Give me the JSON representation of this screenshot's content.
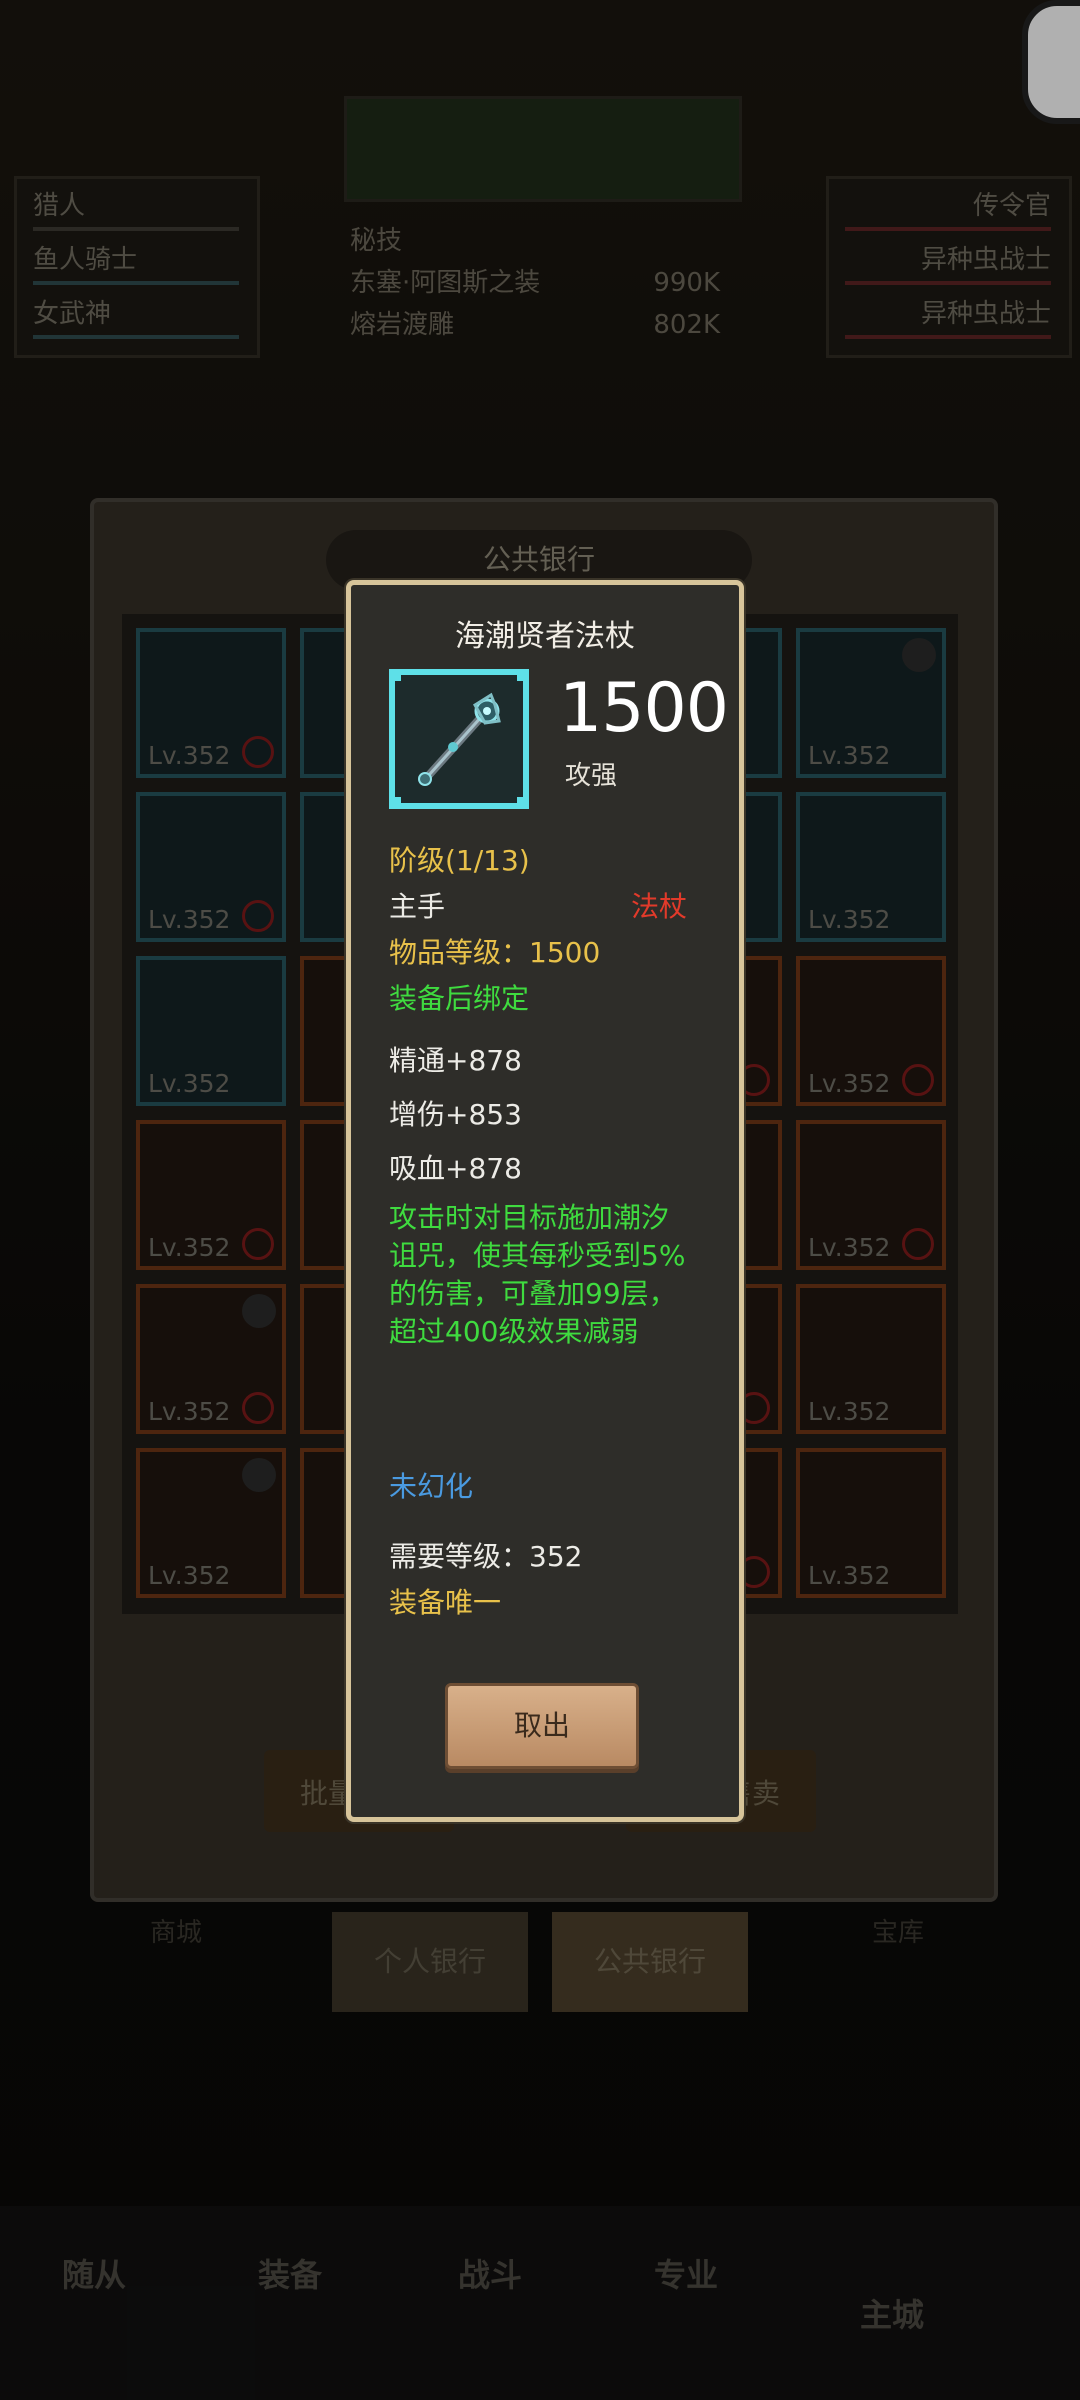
{
  "background": {
    "left_panel": {
      "header": "猎人",
      "rows": [
        "鱼人骑士",
        "女武神"
      ]
    },
    "right_panel": {
      "header": "传令官",
      "rows": [
        "异种虫战士",
        "异种虫战士"
      ]
    },
    "top_panel": {
      "stats": [
        {
          "name": "秘技",
          "value": ""
        },
        {
          "name": "东塞·阿图斯之装",
          "value": "990K"
        },
        {
          "name": "熔岩渡雕",
          "value": "802K"
        }
      ]
    },
    "bank": {
      "title": "公共银行",
      "level_label": "Lv.352",
      "batch_button": "批量",
      "sell_button": "售卖",
      "tabs": [
        "个人银行",
        "公共银行"
      ],
      "left_tab": "商城",
      "right_tab": "宝库"
    },
    "bottom_nav": [
      "随从",
      "装备",
      "战斗",
      "专业",
      "主城"
    ]
  },
  "item": {
    "name": "海潮贤者法杖",
    "power": "1500",
    "power_label": "攻强",
    "tier": "阶级(1/13)",
    "slot": "主手",
    "type": "法杖",
    "item_level": "物品等级：1500",
    "bind": "装备后绑定",
    "stats": [
      "精通+878",
      "增伤+853",
      "吸血+878"
    ],
    "effect": "攻击时对目标施加潮汐诅咒，使其每秒受到5%的伤害，可叠加99层，超过400级效果减弱",
    "transmog": "未幻化",
    "required_level": "需要等级：352",
    "unique": "装备唯一",
    "action_button": "取出"
  },
  "colors": {
    "frame_border": "#d7c49a",
    "rarity_cyan": "#5ee0e8",
    "gold_text": "#e8c14a",
    "green_text": "#3fdb3f",
    "blue_text": "#4a9ae0",
    "red_text": "#e23a2a"
  }
}
